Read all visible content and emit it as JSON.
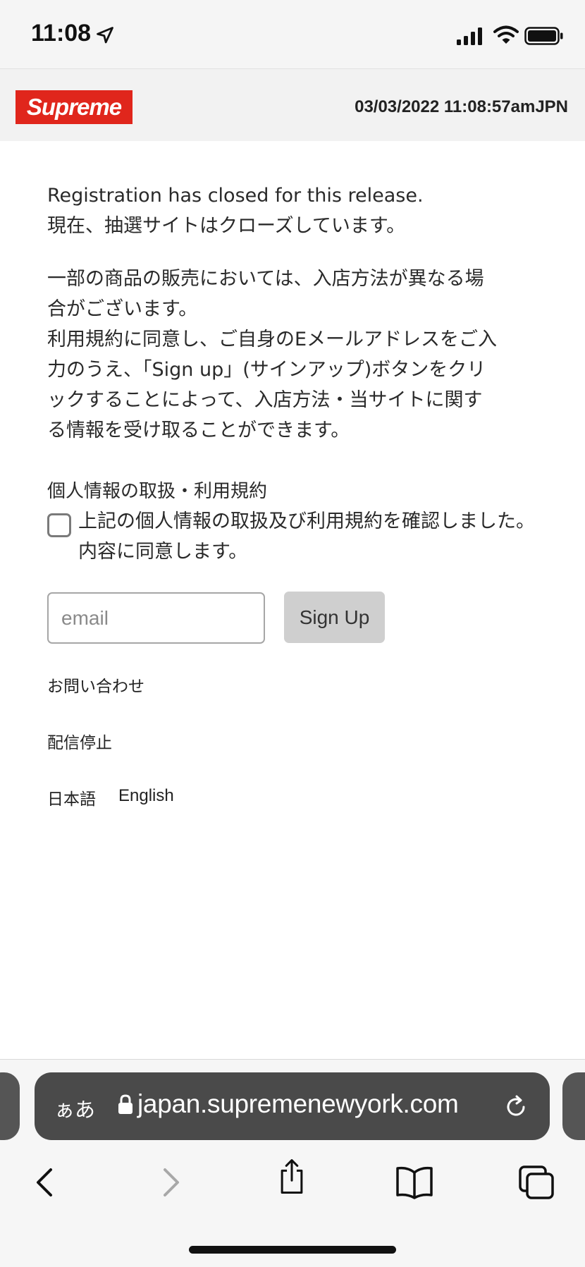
{
  "status_bar": {
    "time": "11:08",
    "location_icon": "location-arrow-icon",
    "signal_icon": "cellular-signal-icon",
    "wifi_icon": "wifi-icon",
    "battery_icon": "battery-icon"
  },
  "header": {
    "logo_text": "Supreme",
    "logo_color": "#e0261c",
    "timestamp": "03/03/2022 11:08:57amJPN"
  },
  "main": {
    "closed_en": "Registration has closed for this release.",
    "closed_jp": "現在、抽選サイトはクローズしています。",
    "info_lines": [
      "一部の商品の販売においては、入店方法が異なる場",
      "合がございます。",
      "利用規約に同意し、ご自身のEメールアドレスをご入",
      "力のうえ、「Sign up」(サインアップ)ボタンをクリ",
      "ックすることによって、入店方法・当サイトに関す",
      "る情報を受け取ることができます。"
    ],
    "consent_title": "個人情報の取扱・利用規約",
    "consent_line1": "上記の個人情報の取扱及び利用規約を確認しました。",
    "consent_line2": "内容に同意します。",
    "email_placeholder": "email",
    "signup_label": "Sign Up",
    "contact_link": "お問い合わせ",
    "unsubscribe_link": "配信停止",
    "lang_jp": "日本語",
    "lang_en": "English"
  },
  "browser": {
    "aa_label": "ぁあ",
    "url": "japan.supremenewyork.com",
    "lock_icon": "lock-icon",
    "reload_icon": "reload-icon",
    "back_icon": "back-chevron-icon",
    "forward_icon": "forward-chevron-icon",
    "share_icon": "share-icon",
    "bookmarks_icon": "bookmarks-icon",
    "tabs_icon": "tabs-icon"
  }
}
